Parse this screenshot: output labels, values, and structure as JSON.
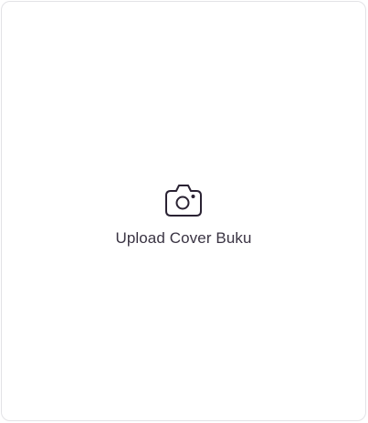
{
  "upload": {
    "label": "Upload Cover Buku",
    "icon": "camera-icon",
    "icon_color": "#2a2233",
    "border_color": "#e3e3e6"
  }
}
